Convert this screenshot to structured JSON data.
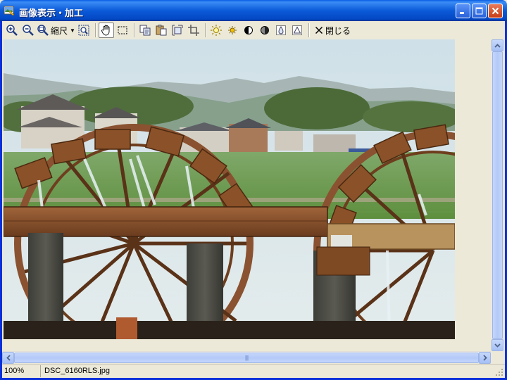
{
  "window": {
    "title": "画像表示・加工",
    "icons": {
      "app": "image-viewer-icon",
      "minimize": "minimize-icon",
      "maximize": "maximize-icon",
      "close": "close-icon"
    },
    "colors": {
      "titlebar": "#0b5ad8",
      "frame": "#0831d9",
      "close_button": "#c63c16",
      "face": "#ece9d8"
    }
  },
  "toolbar": {
    "zoom_menu_label": "縮尺",
    "close_label": "閉じる",
    "buttons": [
      "zoom-in-icon",
      "zoom-out-icon",
      "zoom-menu-icon",
      "fit-to-window-icon",
      "hand-pan-icon",
      "rectangle-select-icon",
      "copy-icon",
      "paste-icon",
      "resize-icon",
      "crop-icon",
      "brightness-up-icon",
      "brightness-down-icon",
      "contrast-up-icon",
      "contrast-down-icon",
      "saturation-icon",
      "sharpen-icon",
      "close-x-icon"
    ],
    "pressed": "hand-pan-icon"
  },
  "image": {
    "subject": "waterwheel-photo"
  },
  "scroll": {
    "vertical_grip": "scroll-grip-icon",
    "horizontal_grip": "scroll-grip-icon"
  },
  "statusbar": {
    "zoom": "100%",
    "filename": "DSC_6160RLS.jpg"
  }
}
